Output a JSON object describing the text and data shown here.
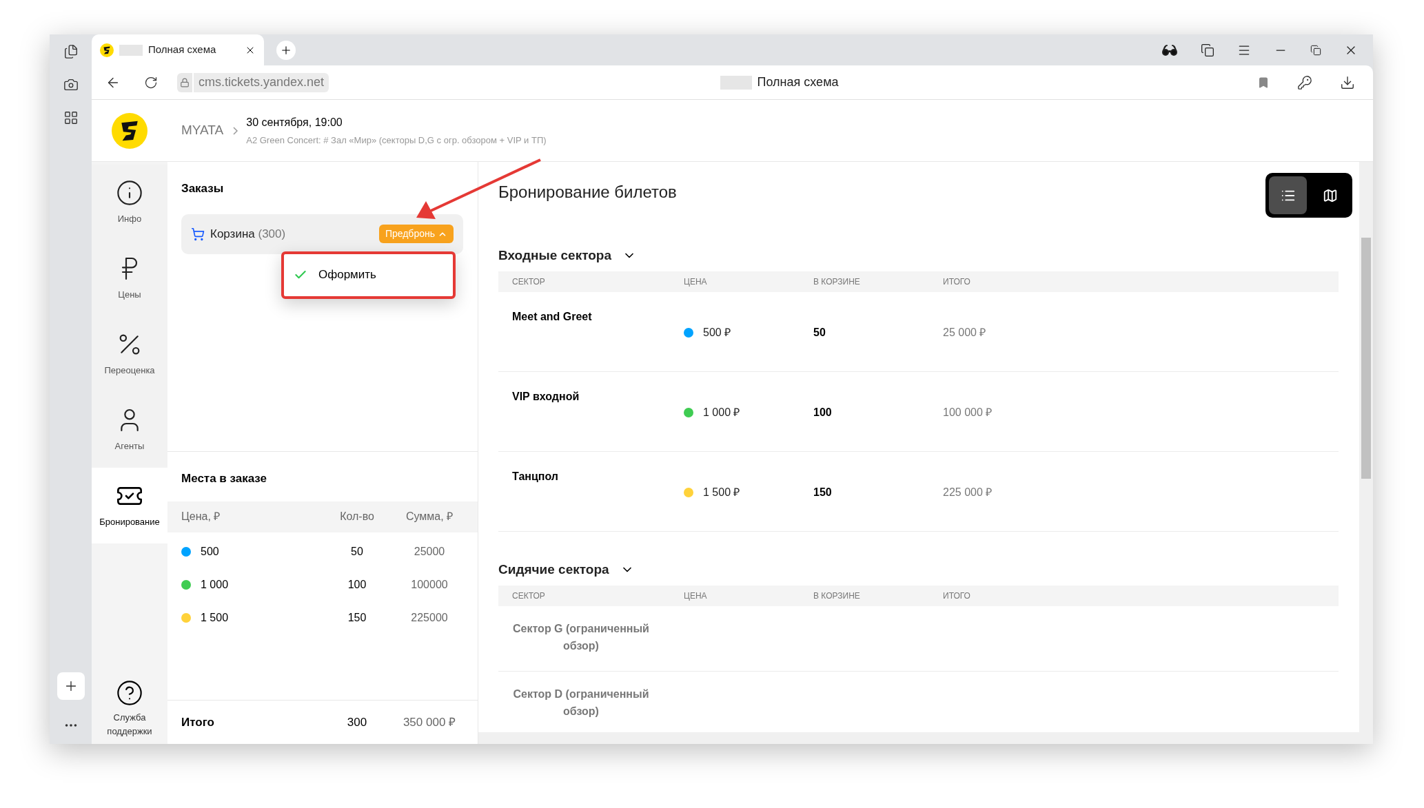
{
  "browser": {
    "tabs": [
      {
        "title": "Полная схема",
        "selected": true
      }
    ],
    "address": "cms.tickets.yandex.net",
    "page_title": "Полная схема"
  },
  "header": {
    "breadcrumb": "MYATA",
    "date": "30 сентября, 19:00",
    "subtitle": "A2 Green Concert: # Зал «Мир» (секторы D,G с огр. обзором + VIP и ТП)"
  },
  "nav": {
    "items": [
      {
        "kind": "info",
        "label": "Инфо",
        "selected": false
      },
      {
        "kind": "prices",
        "label": "Цены",
        "selected": false
      },
      {
        "kind": "revaluation",
        "label": "Переоценка",
        "selected": false
      },
      {
        "kind": "agents",
        "label": "Агенты",
        "selected": false
      },
      {
        "kind": "booking",
        "label": "Бронирование",
        "selected": true
      }
    ],
    "support": "Служба поддержки"
  },
  "orders": {
    "title": "Заказы",
    "cart": {
      "label": "Корзина",
      "count": "(300)"
    },
    "status_button": {
      "label": "Предбронь",
      "expanded": true
    },
    "menu": [
      {
        "label": "Оформить",
        "checked": true
      }
    ]
  },
  "seats": {
    "title": "Места в заказе",
    "columns": [
      "Цена, ₽",
      "Кол-во",
      "Сумма, ₽"
    ],
    "rows": [
      {
        "color": "#00a3ff",
        "price": "500",
        "qty": "50",
        "sum": "25000"
      },
      {
        "color": "#3fcc52",
        "price": "1 000",
        "qty": "100",
        "sum": "100000"
      },
      {
        "color": "#ffd23a",
        "price": "1 500",
        "qty": "150",
        "sum": "225000"
      }
    ],
    "total": {
      "label": "Итого",
      "qty": "300",
      "sum": "350 000 ₽"
    }
  },
  "main": {
    "title": "Бронирование билетов",
    "view_toggle": [
      {
        "kind": "list",
        "selected": true
      },
      {
        "kind": "map",
        "selected": false
      }
    ],
    "sections": [
      {
        "title": "Входные сектора",
        "expanded": true,
        "columns": [
          "СЕКТОР",
          "ЦЕНА",
          "В КОРЗИНЕ",
          "ИТОГО"
        ],
        "rows": [
          {
            "sector": "Meet and Greet",
            "color": "#00a3ff",
            "price": "500 ₽",
            "in_cart": "50",
            "total": "25 000 ₽"
          },
          {
            "sector": "VIP входной",
            "color": "#3fcc52",
            "price": "1 000 ₽",
            "in_cart": "100",
            "total": "100 000 ₽"
          },
          {
            "sector": "Танцпол",
            "color": "#ffd23a",
            "price": "1 500 ₽",
            "in_cart": "150",
            "total": "225 000 ₽"
          }
        ]
      },
      {
        "title": "Сидячие сектора",
        "expanded": true,
        "columns": [
          "СЕКТОР",
          "ЦЕНА",
          "В КОРЗИНЕ",
          "ИТОГО"
        ],
        "rows": [
          {
            "sector": "Сектор G (ограниченный обзор)"
          },
          {
            "sector": "Сектор D (ограниченный обзор)"
          }
        ]
      }
    ]
  }
}
